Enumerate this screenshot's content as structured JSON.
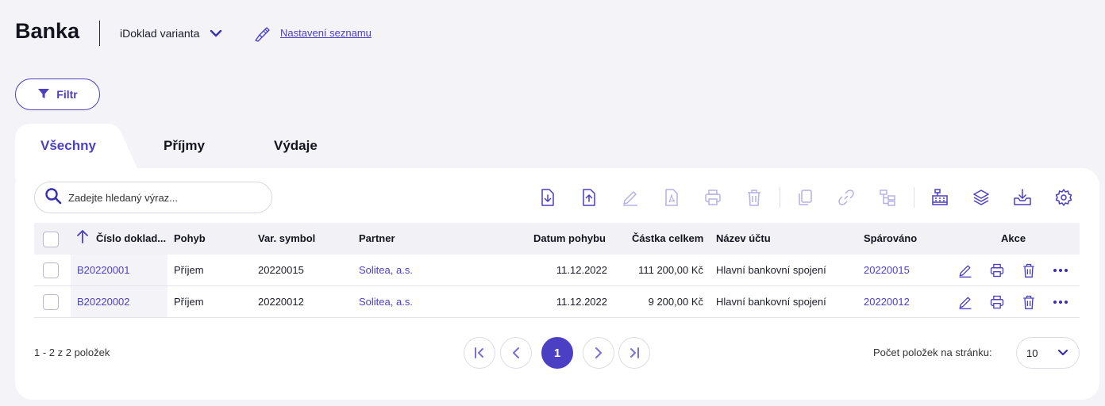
{
  "header": {
    "title": "Banka",
    "variant": "iDoklad varianta",
    "settings_link": "Nastavení seznamu"
  },
  "filter": {
    "label": "Filtr"
  },
  "tabs": [
    {
      "label": "Všechny",
      "active": true
    },
    {
      "label": "Příjmy",
      "active": false
    },
    {
      "label": "Výdaje",
      "active": false
    }
  ],
  "search": {
    "placeholder": "Zadejte hledaný výraz..."
  },
  "toolbar": {
    "icons": [
      "import-icon",
      "export-icon",
      "edit-icon",
      "pdf-icon",
      "print-icon",
      "delete-icon",
      "copy-icon",
      "link-icon",
      "tree-icon",
      "cash-register-icon",
      "layers-icon",
      "download-icon",
      "settings-gear-icon"
    ]
  },
  "table": {
    "columns": [
      "Číslo doklad...",
      "Pohyb",
      "Var. symbol",
      "Partner",
      "Datum pohybu",
      "Částka celkem",
      "Název účtu",
      "Spárováno",
      "Akce"
    ],
    "sort": {
      "column": "Číslo doklad...",
      "direction": "asc"
    },
    "rows": [
      {
        "number": "B20220001",
        "movement": "Příjem",
        "var_symbol": "20220015",
        "partner": "Solitea, a.s.",
        "date": "11.12.2022",
        "amount": "111 200,00 Kč",
        "account": "Hlavní bankovní spojení",
        "paired": "20220015"
      },
      {
        "number": "B20220002",
        "movement": "Příjem",
        "var_symbol": "20220012",
        "partner": "Solitea, a.s.",
        "date": "11.12.2022",
        "amount": "9 200,00 Kč",
        "account": "Hlavní bankovní spojení",
        "paired": "20220012"
      }
    ]
  },
  "pagination": {
    "summary": "1 - 2 z 2 položek",
    "current_page": "1",
    "per_page_label": "Počet položek na stránku:",
    "per_page_value": "10"
  },
  "colors": {
    "accent": "#4b3fc4",
    "background": "#f4f4f8",
    "card": "#ffffff"
  }
}
